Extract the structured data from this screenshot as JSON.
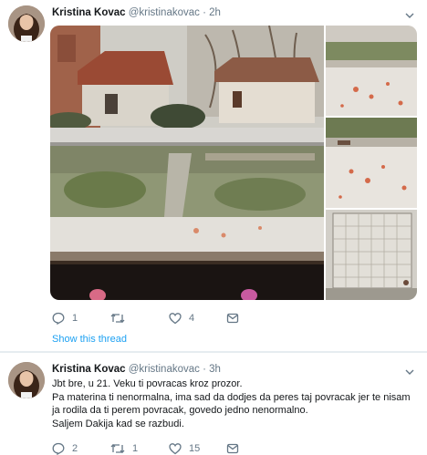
{
  "tweets": [
    {
      "author": {
        "name": "Kristina Kovac",
        "handle": "@kristinakovac"
      },
      "separator": "·",
      "time": "2h",
      "actions": {
        "reply": "1",
        "retweet": "",
        "like": "4"
      },
      "show_thread": "Show this thread"
    },
    {
      "author": {
        "name": "Kristina Kovac",
        "handle": "@kristinakovac"
      },
      "separator": "·",
      "time": "3h",
      "lines": [
        "Jbt bre, u 21. Veku ti povracas kroz prozor.",
        "Pa materina ti nenormalna, ima sad da dodjes da peres taj povracak jer te nisam",
        "ja rodila da ti perem povracak, govedo jedno nenormalno.",
        "Saljem Dakija kad se razbudi."
      ],
      "actions": {
        "reply": "2",
        "retweet": "1",
        "like": "15"
      }
    }
  ],
  "colors": {
    "link": "#1da1f2",
    "muted": "#657786",
    "text": "#14171a",
    "divider": "#e6ecf0"
  },
  "icons": [
    "avatar",
    "chevron-down-icon",
    "reply-icon",
    "retweet-icon",
    "like-icon",
    "share-icon"
  ]
}
